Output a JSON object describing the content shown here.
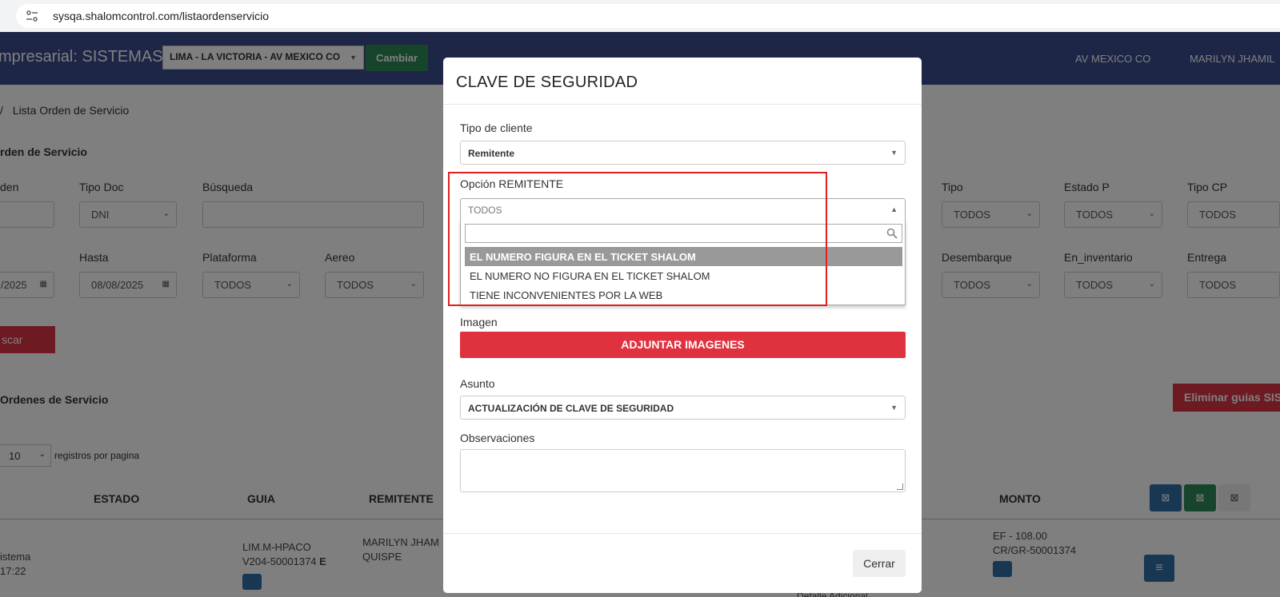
{
  "browser": {
    "url": "sysqa.shalomcontrol.com/listaordenservicio"
  },
  "header": {
    "brand": "mpresarial: SISTEMAS",
    "agency": "LIMA - LA VICTORIA - AV MEXICO CO",
    "cambiar_label": "Cambiar",
    "agency_right": "AV MEXICO CO",
    "user": "MARILYN JHAMIL"
  },
  "breadcrumb": {
    "sep": "/",
    "current": "Lista Orden de Servicio"
  },
  "filters": {
    "section_title": "rden de Servicio",
    "labels": {
      "orden": "den",
      "tipo_doc": "Tipo Doc",
      "busqueda": "Búsqueda",
      "tipo": "Tipo",
      "estado_p": "Estado P",
      "tipo_cp": "Tipo CP",
      "hasta": "Hasta",
      "plataforma": "Plataforma",
      "aereo": "Aereo",
      "desembarque": "Desembarque",
      "en_inventario": "En_inventario",
      "entrega": "Entrega"
    },
    "values": {
      "tipo_doc": "DNI",
      "tipo": "TODOS",
      "estado_p": "TODOS",
      "tipo_cp": "TODOS",
      "desde": "/2025",
      "hasta": "08/08/2025",
      "plataforma": "TODOS",
      "aereo": "TODOS",
      "desembarque": "TODOS",
      "en_inventario": "TODOS",
      "entrega": "TODOS"
    },
    "buscar_label": "scar"
  },
  "list": {
    "title": "Ordenes de Servicio",
    "eliminar_label": "Eliminar guias SISTE",
    "per_page_value": "10",
    "per_page_label": "registros por pagina",
    "columns": [
      "ESTADO",
      "GUIA",
      "REMITENTE",
      "MONTO"
    ],
    "row": {
      "estado": [
        "istema",
        "17:22"
      ],
      "guia": [
        "LIM.M-HPACO",
        "V204-50001374"
      ],
      "guia_mark": "E",
      "remitente": [
        "MARILYN JHAM",
        "QUISPE"
      ],
      "monto": [
        "EF - 108.00",
        "CR/GR-50001374"
      ],
      "detalle": "Detalle Adicional"
    }
  },
  "modal": {
    "title": "CLAVE DE SEGURIDAD",
    "tipo_cliente_label": "Tipo de cliente",
    "tipo_cliente_value": "Remitente",
    "opcion_label": "Opción REMITENTE",
    "opcion_value": "TODOS",
    "options": [
      "EL NUMERO FIGURA EN EL TICKET SHALOM",
      "EL NUMERO NO FIGURA EN EL TICKET SHALOM",
      "TIENE INCONVENIENTES POR LA WEB"
    ],
    "imagen_label": "Imagen",
    "adjuntar_label": "ADJUNTAR IMAGENES",
    "asunto_label": "Asunto",
    "asunto_value": "ACTUALIZACIÓN DE CLAVE DE SEGURIDAD",
    "observaciones_label": "Observaciones",
    "cerrar_label": "Cerrar"
  },
  "colors": {
    "header": "#3b4d8c",
    "danger": "#e0313f",
    "success": "#2e8b57",
    "primary": "#2f6ea5",
    "highlight": "#e02020"
  },
  "icons": [
    "tune-icon",
    "caret-down-icon",
    "calendar-icon",
    "excel-icon",
    "pdf-icon",
    "globe-icon",
    "search-icon",
    "menu-icon"
  ]
}
